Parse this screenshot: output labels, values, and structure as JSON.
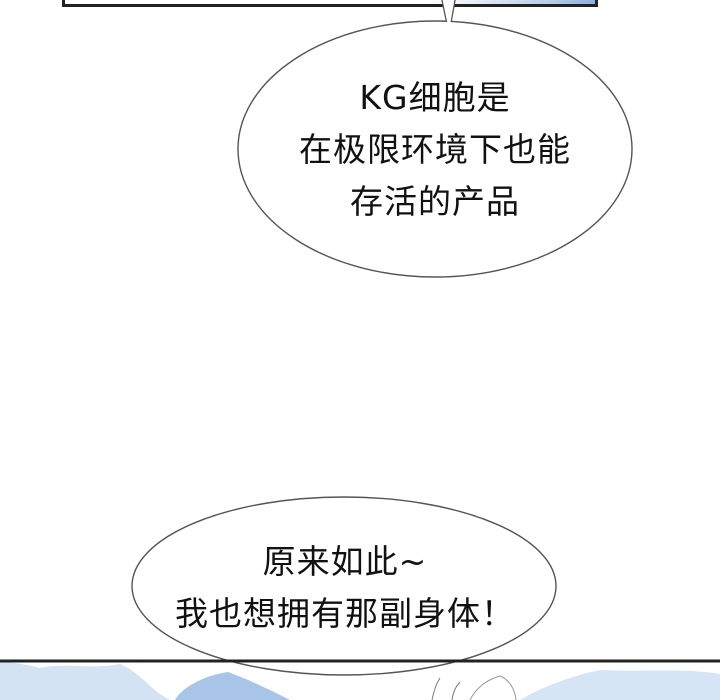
{
  "bubbles": [
    {
      "lines": [
        "KG细胞是",
        "在极限环境下也能",
        "存活的产品"
      ]
    },
    {
      "lines": [
        "原来如此~",
        "我也想拥有那副身体！"
      ]
    }
  ]
}
